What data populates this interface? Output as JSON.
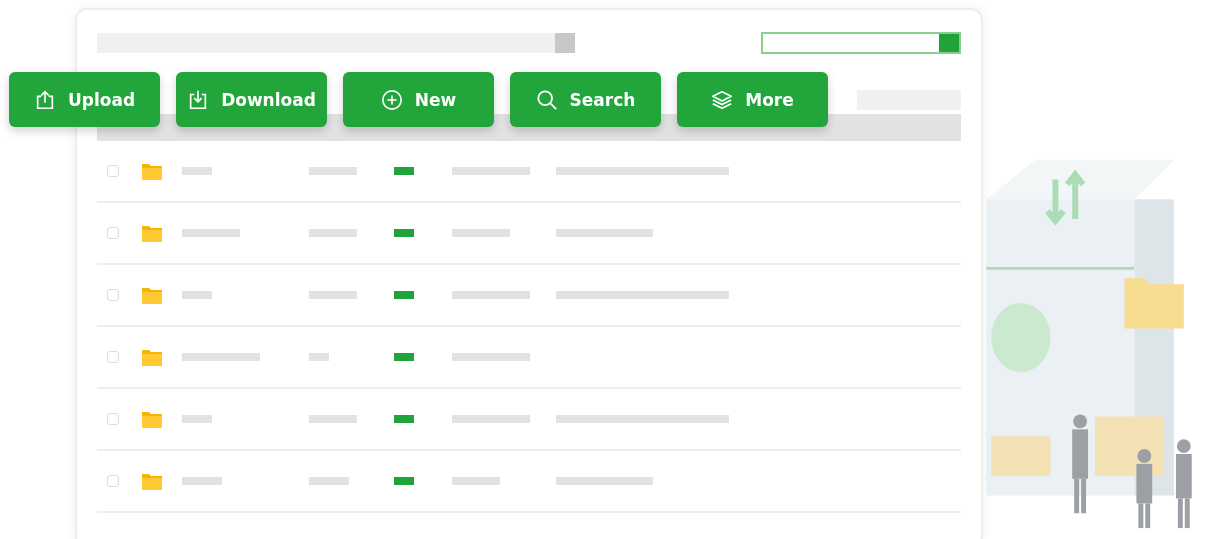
{
  "toolbar": [
    {
      "kind": "upload",
      "label": "Upload"
    },
    {
      "kind": "download",
      "label": "Download"
    },
    {
      "kind": "new",
      "label": "New"
    },
    {
      "kind": "search",
      "label": "Search"
    },
    {
      "kind": "more",
      "label": "More"
    }
  ],
  "rows": [
    {
      "checked": false
    },
    {
      "checked": false
    },
    {
      "checked": false
    },
    {
      "checked": false
    },
    {
      "checked": false
    },
    {
      "checked": false
    }
  ]
}
